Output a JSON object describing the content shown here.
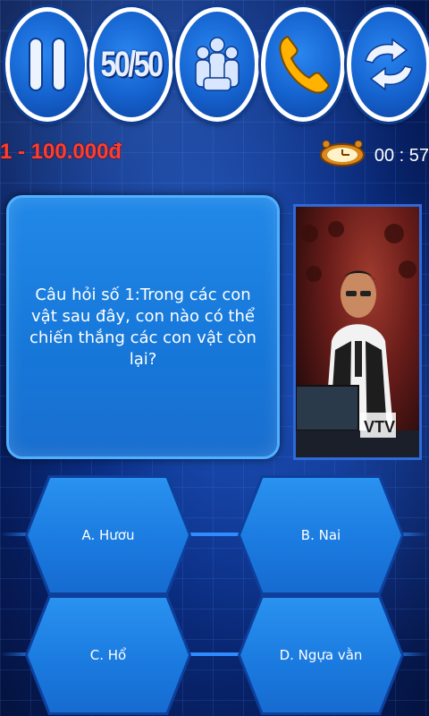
{
  "lifelines": {
    "pause_icon": "pause-icon",
    "fifty_fifty_label": "50/50",
    "audience_icon": "audience-icon",
    "phone_icon": "phone-icon",
    "switch_icon": "switch-question-icon"
  },
  "prize": {
    "label": "1 - 100.000đ"
  },
  "timer": {
    "icon": "alarm-clock-icon",
    "text": "00 : 57"
  },
  "question": {
    "text": "Câu hỏi số 1:Trong các con vật sau đây, con nào có thể chiến thắng các con vật còn lại?"
  },
  "host_image": {
    "watermark": "VTV"
  },
  "answers": [
    {
      "label": "A. Hươu"
    },
    {
      "label": "B. Nai"
    },
    {
      "label": "C. Hổ"
    },
    {
      "label": "D. Ngựa vằn"
    }
  ],
  "colors": {
    "prize_red": "#ff3d2e",
    "panel_blue": "#1677d9",
    "button_blue": "#1563cf"
  }
}
